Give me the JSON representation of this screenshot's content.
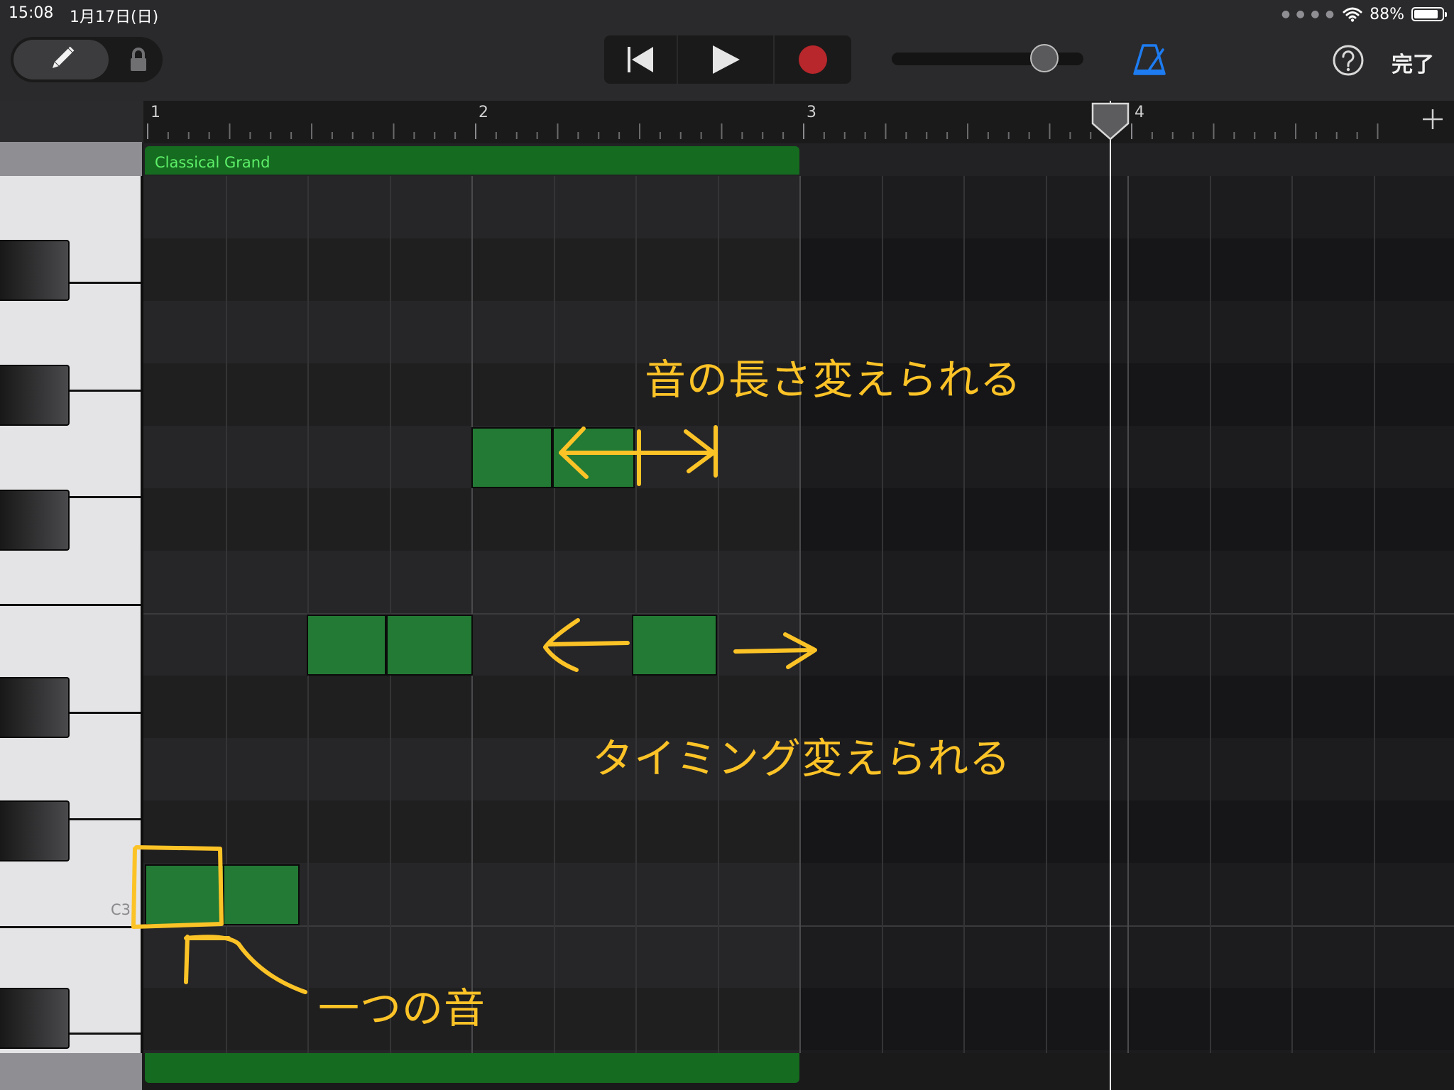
{
  "status": {
    "time": "15:08",
    "date": "1月17日(日)",
    "battery": "88%",
    "battery_level": 0.88
  },
  "toolbar": {
    "done_label": "完了",
    "volume_level": 0.77
  },
  "ruler": {
    "bars": [
      "1",
      "2",
      "3",
      "4"
    ]
  },
  "region": {
    "name": "Classical Grand",
    "color": "#156b1f"
  },
  "piano": {
    "c3_label": "C3"
  },
  "annotations": {
    "length_note": "音の長さ変えられる",
    "timing_note": "タイミング変えられる",
    "single_note": "一つの音",
    "color": "#fcc327"
  },
  "icons": [
    "pencil-icon",
    "lock-icon",
    "rewind-icon",
    "play-icon",
    "record-icon",
    "metronome-icon",
    "help-icon",
    "wifi-icon",
    "plus-icon",
    "playhead-icon"
  ]
}
